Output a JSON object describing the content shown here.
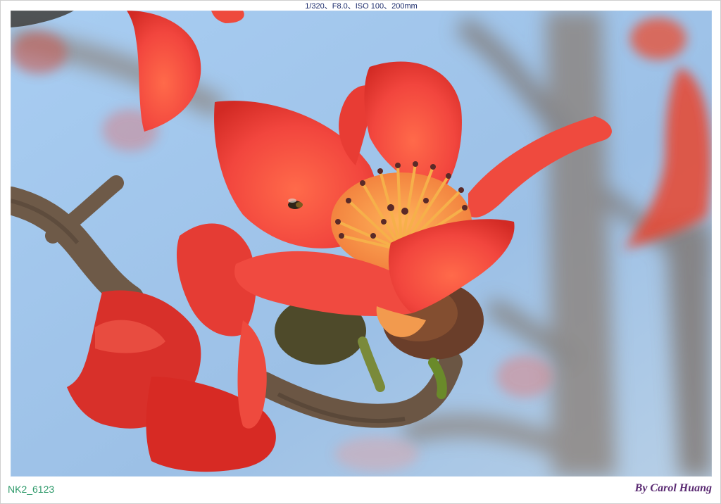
{
  "exif_text": "1/320、F8.0、ISO 100、200mm",
  "file_name": "NK2_6123",
  "signature": "By Carol Huang",
  "colors": {
    "sky": "#9ec4ea",
    "petal": "#f0463e",
    "petal_dark": "#c8261e",
    "stamen": "#f4a640",
    "branch": "#6b5a4a",
    "caption_green": "#2e9a6a",
    "signature_purple": "#5a2a72"
  }
}
